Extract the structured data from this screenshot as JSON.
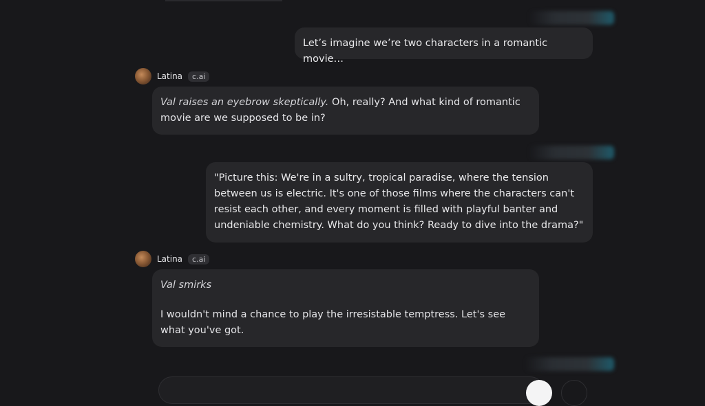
{
  "messages": {
    "user1": {
      "text": "Let’s imagine we’re two characters in a romantic movie…"
    },
    "bot1": {
      "name": "Latina",
      "badge": "c.ai",
      "action": "Val raises an eyebrow skeptically.",
      "text": " Oh, really? And what kind of romantic movie are we supposed to be in?"
    },
    "user2": {
      "text": "\"Picture this: We're in a sultry, tropical paradise, where the tension between us is electric. It's one of those films where the characters can't resist each other, and every moment is filled with playful banter and undeniable chemistry. What do you think? Ready to dive into the drama?\""
    },
    "bot2": {
      "name": "Latina",
      "badge": "c.ai",
      "action": "Val smirks",
      "text": "I wouldn't mind a chance to play the irresistable temptress.  Let's see what you've got."
    }
  },
  "colors": {
    "background": "#18181b",
    "bubble": "#27272a",
    "text": "#e4e4e7",
    "send_button": "#f4f4f5"
  }
}
